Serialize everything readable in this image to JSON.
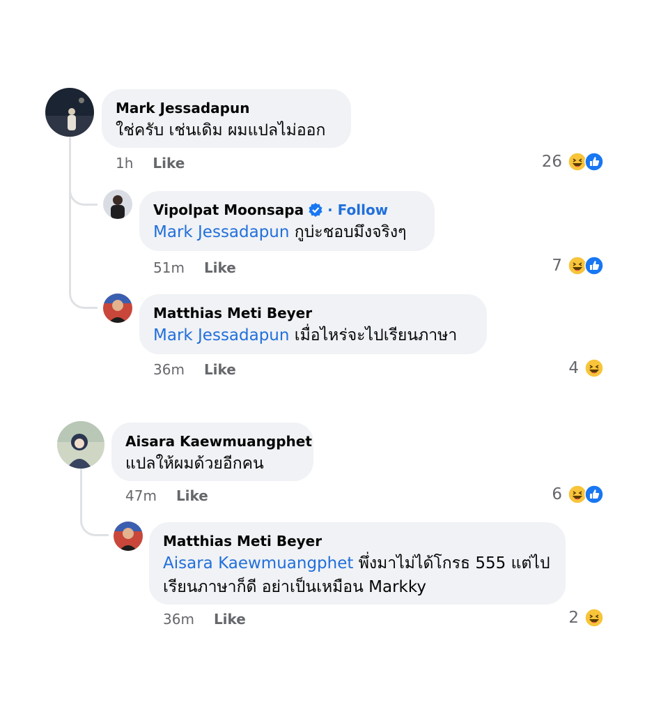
{
  "thread1": {
    "comment": {
      "author": "Mark Jessadapun",
      "text": "ใช่ครับ เช่นเดิม ผมแปลไม่ออก",
      "time": "1h",
      "like_label": "Like",
      "reaction_count": "26",
      "reactions": [
        "haha-icon",
        "like-icon"
      ]
    },
    "replies": [
      {
        "author": "Vipolpat Moonsapa",
        "verified": true,
        "follow_label": "· Follow",
        "mention": "Mark Jessadapun",
        "text": " กูบ่ะชอบมึงจริงๆ",
        "time": "51m",
        "like_label": "Like",
        "reaction_count": "7",
        "reactions": [
          "haha-icon",
          "like-icon"
        ]
      },
      {
        "author": "Matthias Meti Beyer",
        "mention": "Mark Jessadapun",
        "text": " เมื่อไหร่จะไปเรียนภาษา",
        "time": "36m",
        "like_label": "Like",
        "reaction_count": "4",
        "reactions": [
          "haha-icon"
        ]
      }
    ]
  },
  "thread2": {
    "comment": {
      "author": "Aisara Kaewmuangphet",
      "text": "แปลให้ผมด้วยอีกคน",
      "time": "47m",
      "like_label": "Like",
      "reaction_count": "6",
      "reactions": [
        "haha-icon",
        "like-icon"
      ]
    },
    "replies": [
      {
        "author": "Matthias Meti Beyer",
        "mention": "Aisara Kaewmuangphet",
        "text_line1": " พึ่งมาไม่ได้โกรธ 555 แต่ไป",
        "text_line2": "เรียนภาษาก็ดี อย่าเป็นเหมือน Markky",
        "time": "36m",
        "like_label": "Like",
        "reaction_count": "2",
        "reactions": [
          "haha-icon"
        ]
      }
    ]
  },
  "colors": {
    "bubble": "#f0f2f5",
    "mention": "#216fdb",
    "meta": "#65676b",
    "thread_line": "#dfe1e5",
    "like_blue": "#1877f2",
    "haha_yellow": "#f7c43a"
  }
}
